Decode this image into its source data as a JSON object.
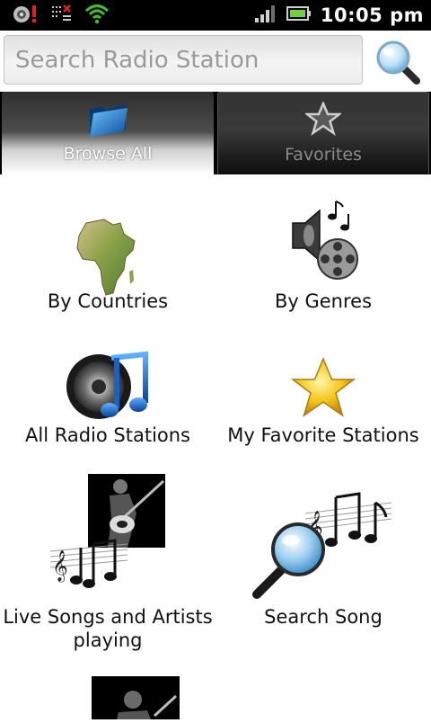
{
  "status_bar": {
    "time": "10:05 pm",
    "icons": [
      "notification-alert-icon",
      "data-disabled-icon",
      "wifi-icon",
      "signal-icon",
      "battery-icon"
    ]
  },
  "search": {
    "placeholder": "Search Radio Station",
    "button_icon": "magnifier-icon"
  },
  "tabs": [
    {
      "label": "Browse All",
      "icon": "folder-icon",
      "selected": true
    },
    {
      "label": "Favorites",
      "icon": "star-icon",
      "selected": false
    }
  ],
  "grid": [
    {
      "label": "By Countries",
      "icon": "africa-map-icon"
    },
    {
      "label": "By Genres",
      "icon": "speaker-film-reel-icon"
    },
    {
      "label": "All Radio Stations",
      "icon": "speaker-music-note-icon"
    },
    {
      "label": "My Favorite Stations",
      "icon": "gold-star-icon"
    },
    {
      "label": "Live Songs and Artists",
      "label2": "playing",
      "icon": "guitarist-music-notes-icon"
    },
    {
      "label": "Search Song",
      "icon": "magnifier-music-notes-icon"
    },
    {
      "label": "",
      "icon": "guitarist-silhouette-icon"
    }
  ],
  "colors": {
    "status_bar": "#000000",
    "tab_bar": "#000000",
    "wifi_green": "#3fbf2a",
    "battery_green": "#6fd23a"
  }
}
